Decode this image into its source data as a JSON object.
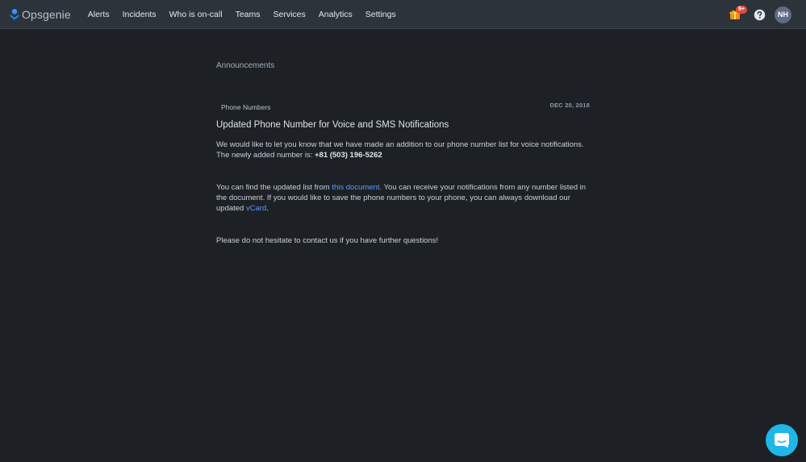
{
  "app": {
    "name": "Opsgenie"
  },
  "nav": {
    "items": [
      {
        "label": "Alerts"
      },
      {
        "label": "Incidents"
      },
      {
        "label": "Who is on-call"
      },
      {
        "label": "Teams"
      },
      {
        "label": "Services"
      },
      {
        "label": "Analytics"
      },
      {
        "label": "Settings"
      }
    ]
  },
  "header_right": {
    "notification_badge": "9+",
    "user_initials": "NH",
    "icons": [
      "gift-icon",
      "help-icon"
    ]
  },
  "breadcrumb": "Announcements",
  "post": {
    "category": "Phone Numbers",
    "date": "DEC 20, 2018",
    "title": "Updated Phone Number for Voice and SMS Notifications",
    "p1_text": "We would like to let you know that we have made an addition to our phone number list for voice notifications. The newly added number is: ",
    "p1_phone": "+81 (503) 196-5262",
    "p2_before": "You can find the updated list from ",
    "p2_link": "this document.",
    "p2_middle": " You can receive your notifications from any number listed in the document. If you would like to save the phone numbers to your phone, you can always download our updated ",
    "p2_link2": "vCard",
    "p2_end": ".",
    "p3_text": "Please do not hesitate to contact us if you have further questions!"
  },
  "colors": {
    "background": "#1d2125",
    "topbar": "#2c333a",
    "link": "#579dff",
    "badge": "#e5493a",
    "chat_button": "#1fb6e8"
  }
}
